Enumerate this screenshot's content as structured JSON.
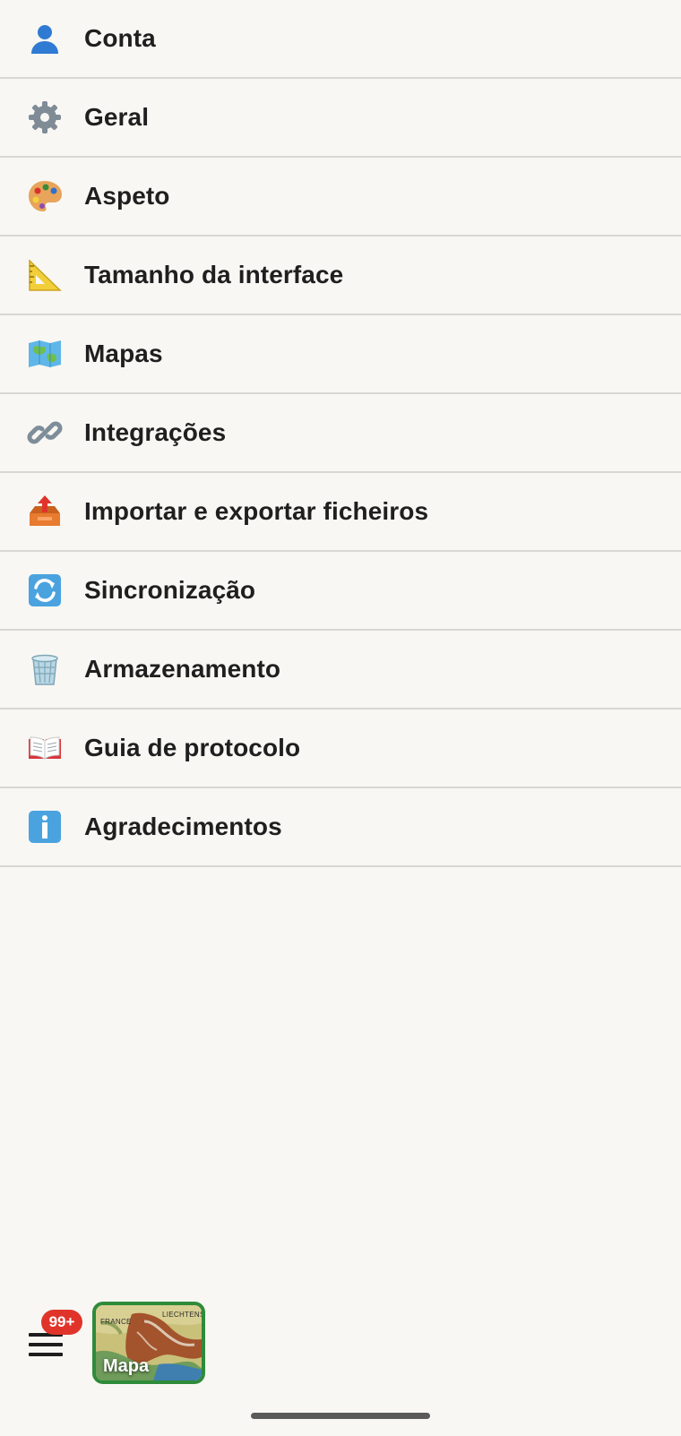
{
  "settings": {
    "items": [
      {
        "label": "Conta",
        "icon": "person-icon"
      },
      {
        "label": "Geral",
        "icon": "gear-icon"
      },
      {
        "label": "Aspeto",
        "icon": "palette-icon"
      },
      {
        "label": "Tamanho da interface",
        "icon": "ruler-icon"
      },
      {
        "label": "Mapas",
        "icon": "map-icon"
      },
      {
        "label": "Integrações",
        "icon": "link-icon"
      },
      {
        "label": "Importar e exportar ficheiros",
        "icon": "outbox-tray-icon"
      },
      {
        "label": "Sincronização",
        "icon": "sync-arrows-icon"
      },
      {
        "label": "Armazenamento",
        "icon": "wastebasket-icon"
      },
      {
        "label": "Guia de protocolo",
        "icon": "open-book-icon"
      },
      {
        "label": "Agradecimentos",
        "icon": "info-icon"
      }
    ]
  },
  "bottom_bar": {
    "badge_count": "99+",
    "map_button_label": "Mapa",
    "map_tags": [
      "FRANCE",
      "LIECHTENS"
    ]
  },
  "colors": {
    "background": "#f9f7f3",
    "divider": "#d9d7d3",
    "badge": "#e0342b",
    "map_border": "#2e8b3a"
  }
}
